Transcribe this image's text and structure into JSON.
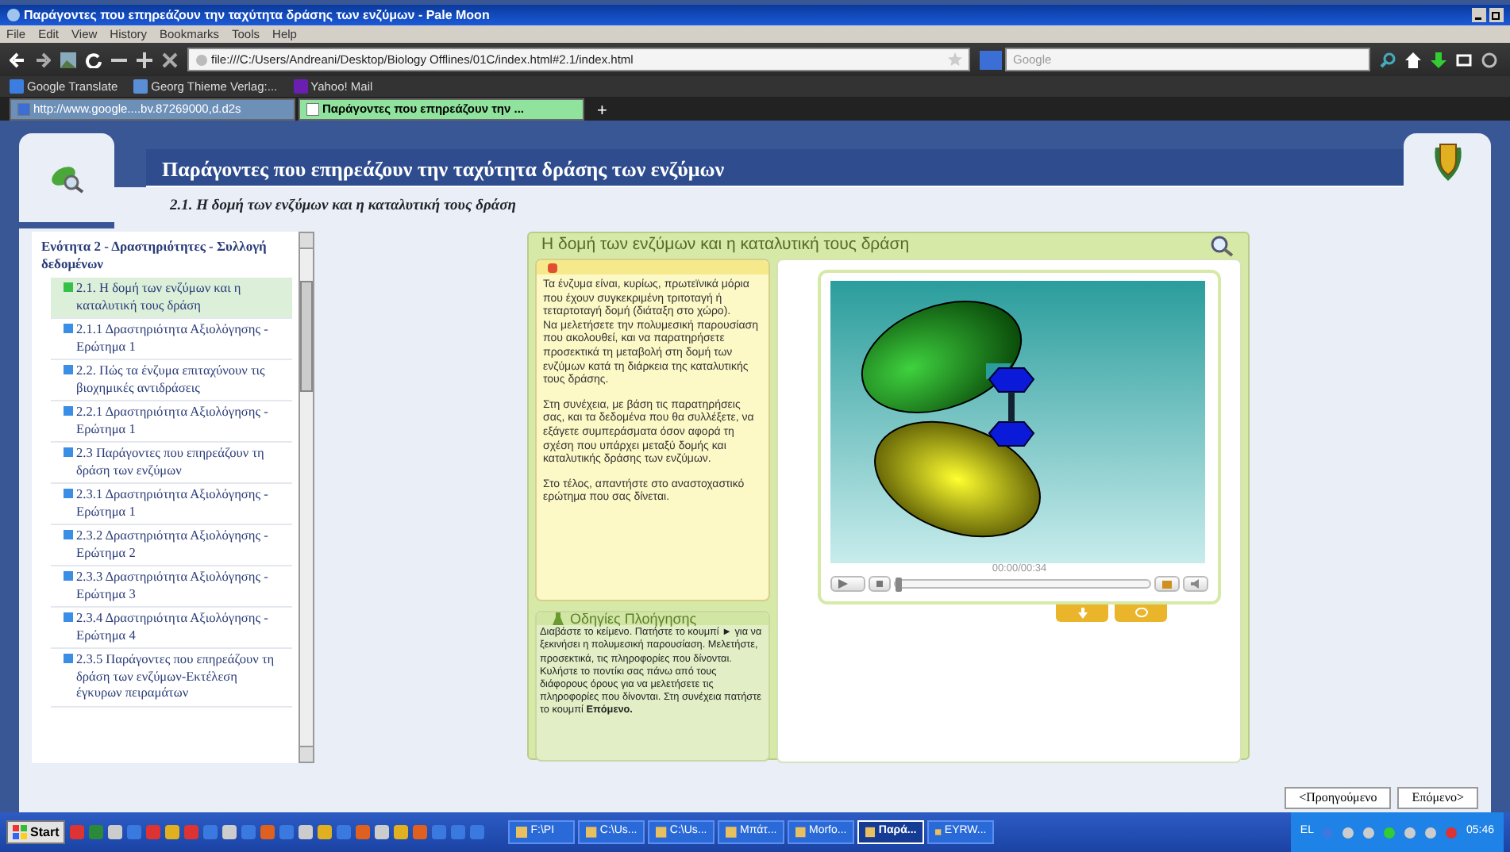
{
  "window": {
    "title": "Παράγοντες που επηρεάζουν την ταχύτητα δράσης των ενζύμων - Pale Moon"
  },
  "menu": [
    "File",
    "Edit",
    "View",
    "History",
    "Bookmarks",
    "Tools",
    "Help"
  ],
  "address": "file:///C:/Users/Andreani/Desktop/Biology Offlines/01C/index.html#2.1/index.html",
  "search": {
    "placeholder": "Google"
  },
  "bookmarks": [
    "Google Translate",
    "Georg Thieme Verlag:...",
    "Yahoo! Mail"
  ],
  "tabs": [
    {
      "label": "http://www.google....bv.87269000,d.d2s",
      "selected": false
    },
    {
      "label": "Παράγοντες που επηρεάζουν την ...",
      "selected": true
    }
  ],
  "new_tab": "+",
  "page": {
    "title": "Παράγοντες που επηρεάζουν την ταχύτητα δράσης των ενζύμων",
    "subtitle": "2.1. Η δομή των ενζύμων και η καταλυτική τους δράση"
  },
  "sidebar": {
    "heading": "Ενότητα 2 - Δραστηριότητες - Συλλογή δεδομένων",
    "items": [
      {
        "label": "2.1. Η δομή των ενζύμων και η καταλυτική τους δράση",
        "selected": true
      },
      {
        "label": "2.1.1 Δραστηριότητα Αξιολόγησης - Ερώτημα 1",
        "selected": false
      },
      {
        "label": "2.2. Πώς τα ένζυμα επιταχύνουν τις βιοχημικές αντιδράσεις",
        "selected": false
      },
      {
        "label": "2.2.1 Δραστηριότητα Αξιολόγησης - Ερώτημα 1",
        "selected": false
      },
      {
        "label": "2.3 Παράγοντες που επηρεάζουν τη δράση των ενζύμων",
        "selected": false
      },
      {
        "label": "2.3.1 Δραστηριότητα Αξιολόγησης - Ερώτημα 1",
        "selected": false
      },
      {
        "label": "2.3.2 Δραστηριότητα Αξιολόγησης - Ερώτημα 2",
        "selected": false
      },
      {
        "label": "2.3.3 Δραστηριότητα Αξιολόγησης - Ερώτημα 3",
        "selected": false
      },
      {
        "label": "2.3.4 Δραστηριότητα Αξιολόγησης - Ερώτημα 4",
        "selected": false
      },
      {
        "label": "2.3.5 Παράγοντες που επηρεάζουν τη δράση των ενζύμων-Εκτέλεση έγκυρων πειραμάτων",
        "selected": false
      }
    ]
  },
  "lesson": {
    "heading": "Η δομή των ενζύμων και η καταλυτική τους δράση",
    "paragraphs": [
      "Τα ένζυμα είναι, κυρίως, πρωτεϊνικά μόρια που έχουν συγκεκριμένη τριτοταγή ή τεταρτοταγή δομή (διάταξη στο χώρο).\nΝα μελετήσετε την πολυμεσική παρουσίαση που ακολουθεί, και να παρατηρήσετε προσεκτικά τη μεταβολή στη δομή των ενζύμων κατά τη διάρκεια της καταλυτικής τους δράσης.",
      "Στη συνέχεια, με βάση τις παρατηρήσεις σας, και τα δεδομένα που θα συλλέξετε, να εξάγετε συμπεράσματα όσον αφορά τη σχέση που υπάρχει μεταξύ δομής και καταλυτικής δράσης των ενζύμων.",
      "Στο τέλος, απαντήστε στο αναστοχαστικό ερώτημα που σας δίνεται."
    ],
    "instructions_title": "Οδηγίες Πλοήγησης",
    "instructions": "Διαβάστε το κείμενο. Πατήστε το κουμπί ► για να ξεκινήσει η πολυμεσική παρουσίαση. Μελετήστε, προσεκτικά, τις πληροφορίες που δίνονται. Κυλήστε το ποντίκι σας πάνω από τους διάφορους όρους για να μελετήσετε τις πληροφορίες που δίνονται. Στη συνέχεια πατήστε το κουμπί **Επόμενο.**"
  },
  "player": {
    "time": "00:00/00:34",
    "progress": {
      "level": 0
    }
  },
  "nav_buttons": [
    "<Προηγούμενο",
    "Επόμενο>"
  ],
  "taskbar": {
    "start": "Start",
    "tasks": [
      {
        "label": "F:\\PI",
        "selected": false
      },
      {
        "label": "C:\\Us...",
        "selected": false
      },
      {
        "label": "C:\\Us...",
        "selected": false
      },
      {
        "label": "Μπάτ...",
        "selected": false
      },
      {
        "label": "Morfo...",
        "selected": false
      },
      {
        "label": "Παρά...",
        "selected": true
      },
      {
        "label": "EYRW...",
        "selected": false
      }
    ],
    "language": "EL",
    "clock": "05:46"
  }
}
